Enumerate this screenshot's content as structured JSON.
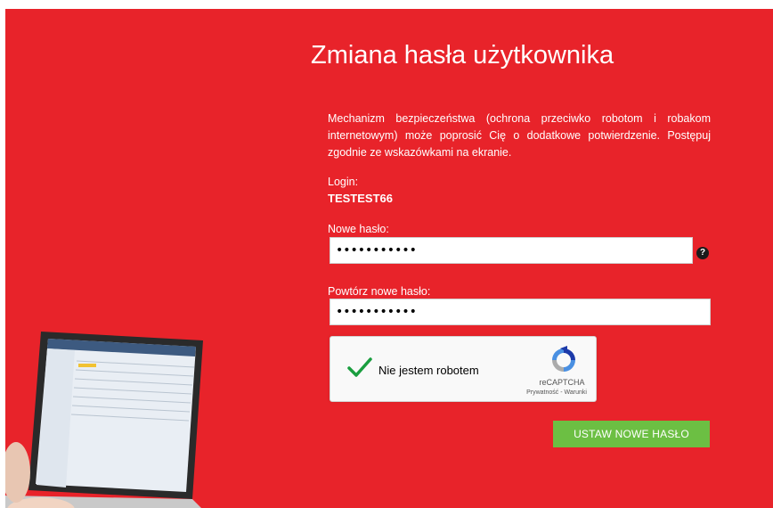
{
  "page": {
    "title": "Zmiana hasła użytkownika",
    "description": "Mechanizm bezpieczeństwa (ochrona przeciwko robotom i robakom internetowym) może poprosić Cię o dodatkowe potwierdzenie. Postępuj zgodnie ze wskazówkami na ekranie."
  },
  "login": {
    "label": "Login:",
    "value": "TESTEST66"
  },
  "new_password": {
    "label": "Nowe hasło:",
    "value": "•••••••••••",
    "help": "?"
  },
  "repeat_password": {
    "label": "Powtórz nowe hasło:",
    "value": "•••••••••••"
  },
  "captcha": {
    "text": "Nie jestem robotem",
    "brand": "reCAPTCHA",
    "terms": "Prywatność - Warunki",
    "checked": true
  },
  "submit": {
    "label": "USTAW NOWE HASŁO"
  },
  "colors": {
    "background": "#e8232a",
    "button": "#6cbf43",
    "check": "#1a9e3f"
  }
}
